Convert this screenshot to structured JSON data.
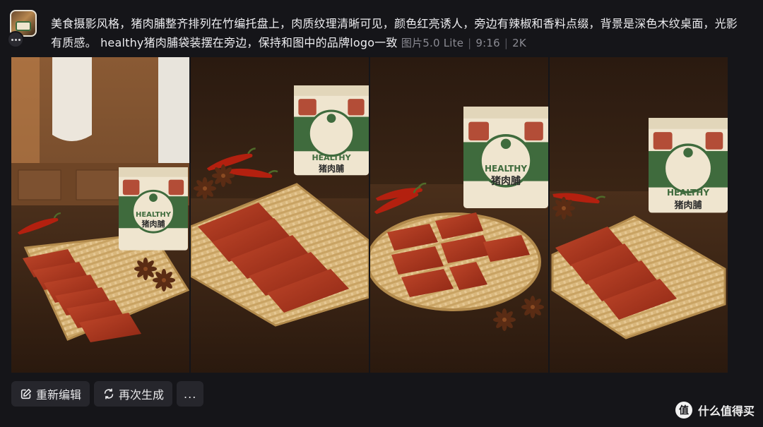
{
  "prompt": {
    "text": "美食摄影风格，猪肉脯整齐排列在竹编托盘上，肉质纹理清晰可见，颜色红亮诱人，旁边有辣椒和香料点缀，背景是深色木纹桌面，光影有质感。 healthy猪肉脯袋装摆在旁边，保持和图中的品牌logo一致",
    "model": "图片5.0 Lite",
    "ratio": "9:16",
    "resolution": "2K"
  },
  "product": {
    "brand": "HEALTHY",
    "name": "猪肉脯"
  },
  "actions": {
    "edit_label": "重新编辑",
    "regenerate_label": "再次生成",
    "more_label": "..."
  },
  "watermark": {
    "logo_char": "值",
    "text": "什么值得买"
  },
  "colors": {
    "background": "#151519",
    "button_bg": "#26262c",
    "meta_text": "#8a8a92",
    "jerky": "#a8321c",
    "package_green": "#3f6b3d",
    "package_cream": "#efe5cf"
  },
  "icons": {
    "edit": "edit-icon",
    "regenerate": "refresh-icon"
  }
}
